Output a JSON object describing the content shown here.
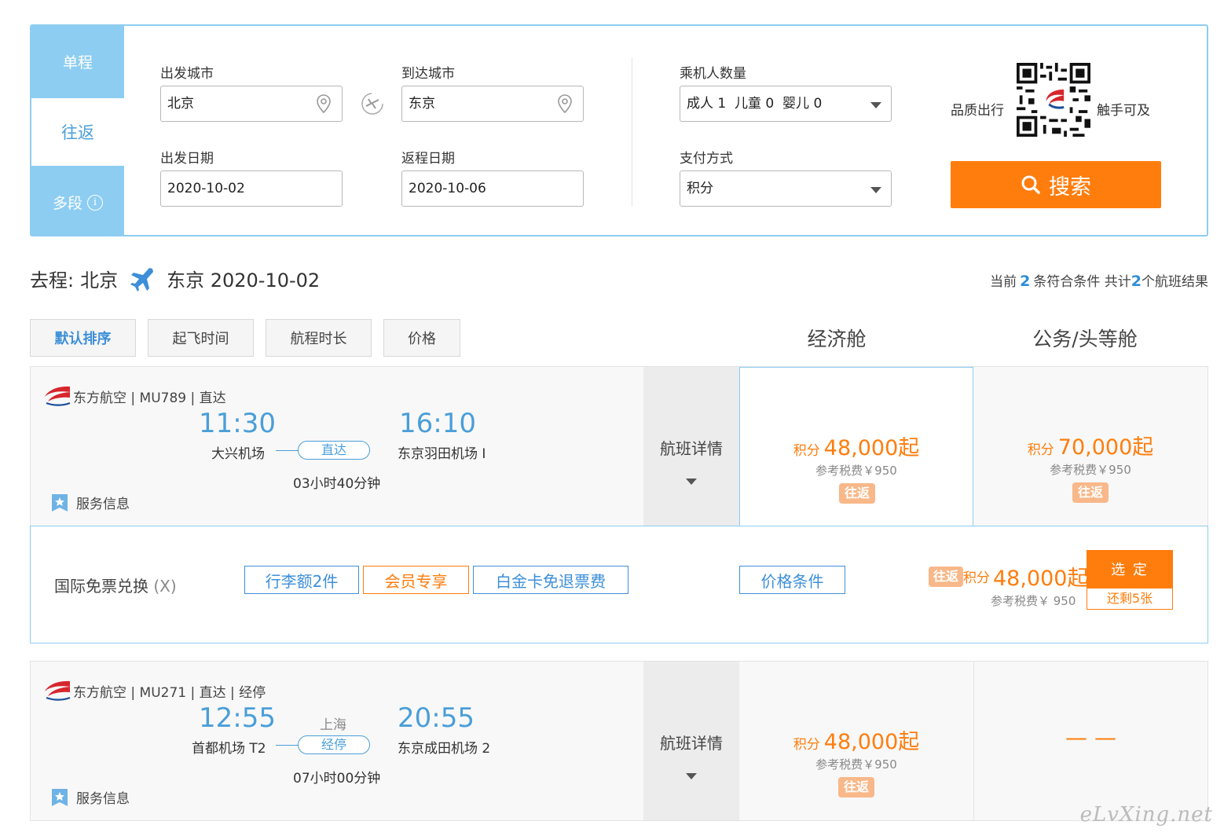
{
  "search": {
    "trip_tabs": [
      {
        "label": "单程"
      },
      {
        "label": "往返"
      },
      {
        "label": "多段"
      }
    ],
    "depart_city_label": "出发城市",
    "depart_city": "北京",
    "arrive_city_label": "到达城市",
    "arrive_city": "东京",
    "depart_date_label": "出发日期",
    "depart_date": "2020-10-02",
    "return_date_label": "返程日期",
    "return_date": "2020-10-06",
    "passengers_label": "乘机人数量",
    "passengers": "成人 1  儿童 0  婴儿 0",
    "payment_label": "支付方式",
    "payment": "积分",
    "brand_left": "品质出行",
    "brand_right": "触手可及",
    "search_button": "搜索"
  },
  "route": {
    "prefix": "去程:",
    "from": "北京",
    "to_date": "东京 2020-10-02",
    "count_pre": "当前",
    "count_a": "2",
    "count_mid": "条符合条件 共计",
    "count_b": "2",
    "count_post": "个航班结果"
  },
  "sort": [
    "默认排序",
    "起飞时间",
    "航程时长",
    "价格"
  ],
  "cabins": [
    "经济舱",
    "公务/头等舱"
  ],
  "flights": [
    {
      "airline": "东方航空 | MU789 | 直达",
      "dep_time": "11:30",
      "arr_time": "16:10",
      "dep_airport": "大兴机场",
      "arr_airport": "东京羽田机场 I",
      "stop_label": "直达",
      "via": "",
      "duration": "03小时40分钟",
      "service": "服务信息",
      "detail": "航班详情",
      "economy": {
        "pre": "积分",
        "amount": "48,000起",
        "tax": "参考税费￥950",
        "badge": "往返"
      },
      "business": {
        "pre": "积分",
        "amount": "70,000起",
        "tax": "参考税费￥950",
        "badge": "往返"
      }
    },
    {
      "airline": "东方航空 | MU271 | 直达 | 经停",
      "dep_time": "12:55",
      "arr_time": "20:55",
      "dep_airport": "首都机场 T2",
      "arr_airport": "东京成田机场 2",
      "stop_label": "经停",
      "via": "上海",
      "duration": "07小时00分钟",
      "service": "服务信息",
      "detail": "航班详情",
      "economy": {
        "pre": "积分",
        "amount": "48,000起",
        "tax": "参考税费￥950",
        "badge": "往返"
      },
      "business_dash": "— —"
    }
  ],
  "fare": {
    "name": "国际免票兑换",
    "name_suffix": "(X)",
    "tags": [
      "行李额2件",
      "会员专享",
      "白金卡免退票费"
    ],
    "conditions": "价格条件",
    "badge": "往返",
    "pre": "积分",
    "amount": "48,000起",
    "tax": "参考税费￥ 950",
    "select": "选 定",
    "remaining": "还剩5张"
  },
  "watermark": "eLvXing.net",
  "colors": {
    "accent_blue": "#4a9fd8",
    "tab_blue": "#8ecdf2",
    "orange": "#ff7d0d",
    "badge_orange": "#f8b889"
  }
}
